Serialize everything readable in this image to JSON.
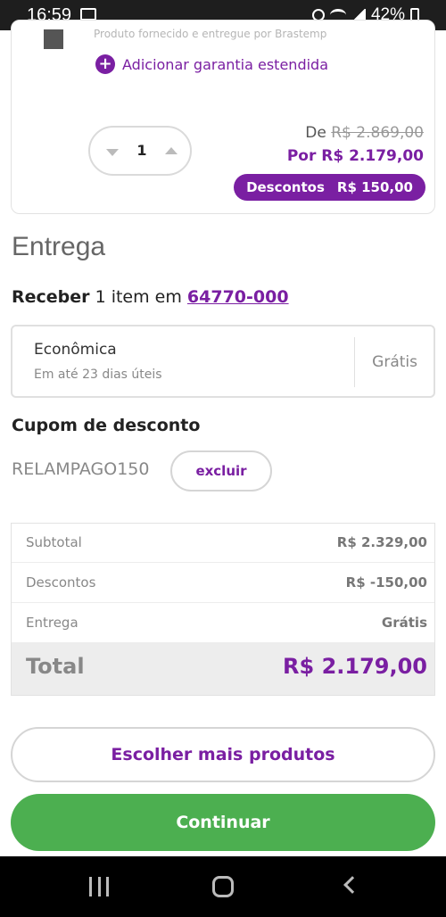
{
  "status_bar": {
    "time": "16:59",
    "battery": "42%"
  },
  "product": {
    "provided_by": "Produto fornecido e entregue por Brastemp",
    "warranty_link": "Adicionar garantia estendida",
    "quantity": "1",
    "price_from_label": "De",
    "price_from": "R$ 2.869,00",
    "price_now": "Por R$ 2.179,00",
    "discount_label": "Descontos",
    "discount_value": "R$ 150,00"
  },
  "delivery": {
    "title": "Entrega",
    "receive_bold": "Receber",
    "receive_text": "1 item em",
    "zip": "64770-000",
    "option_name": "Econômica",
    "option_eta": "Em até 23 dias úteis",
    "option_price": "Grátis"
  },
  "coupon": {
    "title": "Cupom de desconto",
    "code": "RELAMPAGO150",
    "remove_label": "excluir"
  },
  "summary": {
    "rows": [
      {
        "label": "Subtotal",
        "value": "R$ 2.329,00"
      },
      {
        "label": "Descontos",
        "value": "R$ -150,00"
      },
      {
        "label": "Entrega",
        "value": "Grátis"
      }
    ],
    "total_label": "Total",
    "total_value": "R$ 2.179,00"
  },
  "actions": {
    "more_products": "Escolher mais produtos",
    "continue": "Continuar"
  },
  "colors": {
    "brand_purple": "#7a1fa2",
    "continue_green": "#4caf50"
  },
  "icons": [
    "notification-icon",
    "mute-icon",
    "wifi-icon",
    "signal-icon",
    "battery-icon",
    "plus-circle-icon",
    "chevron-down-icon",
    "chevron-up-icon",
    "recent-apps-icon",
    "home-icon",
    "back-icon"
  ]
}
